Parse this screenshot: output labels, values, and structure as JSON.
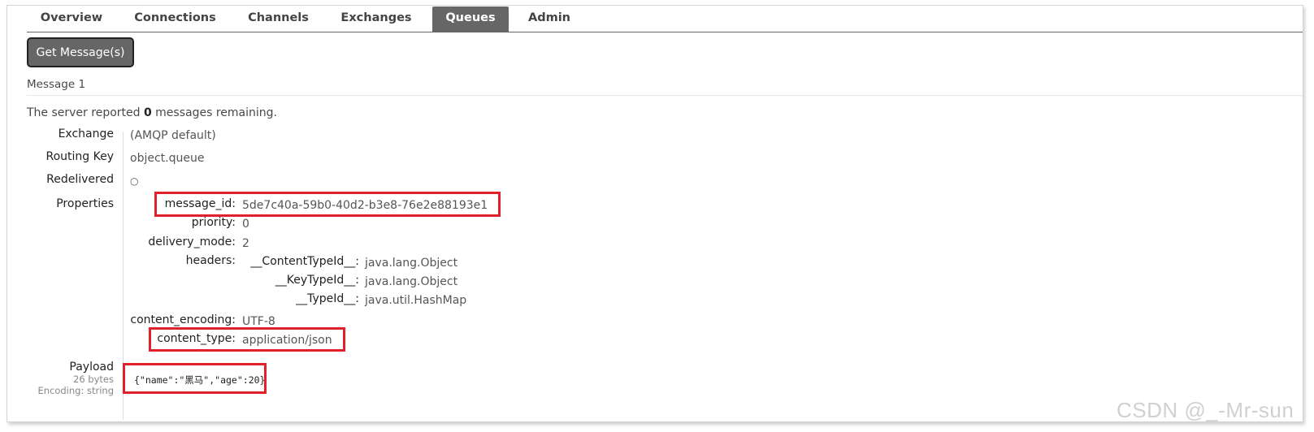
{
  "nav": {
    "tabs": [
      {
        "label": "Overview"
      },
      {
        "label": "Connections"
      },
      {
        "label": "Channels"
      },
      {
        "label": "Exchanges"
      },
      {
        "label": "Queues",
        "active": true
      },
      {
        "label": "Admin"
      }
    ]
  },
  "actions": {
    "get_messages_label": "Get Message(s)"
  },
  "message": {
    "header": "Message 1",
    "remaining_prefix": "The server reported",
    "remaining_count": "0",
    "remaining_suffix": "messages remaining.",
    "fields": {
      "exchange_label": "Exchange",
      "exchange_value": "(AMQP default)",
      "routing_key_label": "Routing Key",
      "routing_key_value": "object.queue",
      "redelivered_label": "Redelivered",
      "redelivered_value": "○",
      "properties_label": "Properties"
    },
    "properties": {
      "message_id_label": "message_id:",
      "message_id_value": "5de7c40a-59b0-40d2-b3e8-76e2e88193e1",
      "priority_label": "priority:",
      "priority_value": "0",
      "delivery_mode_label": "delivery_mode:",
      "delivery_mode_value": "2",
      "headers_label": "headers:",
      "headers": [
        {
          "key": "__ContentTypeId__:",
          "value": "java.lang.Object"
        },
        {
          "key": "__KeyTypeId__:",
          "value": "java.lang.Object"
        },
        {
          "key": "__TypeId__:",
          "value": "java.util.HashMap"
        }
      ],
      "content_encoding_label": "content_encoding:",
      "content_encoding_value": "UTF-8",
      "content_type_label": "content_type:",
      "content_type_value": "application/json"
    },
    "payload": {
      "label": "Payload",
      "size": "26 bytes",
      "encoding": "Encoding: string",
      "content": "{\"name\":\"黑马\",\"age\":20}"
    }
  },
  "watermark": "CSDN @_-Mr-sun",
  "colors": {
    "tab_active_bg": "#666666",
    "highlight_box": "#e0212b",
    "text": "#484848"
  }
}
